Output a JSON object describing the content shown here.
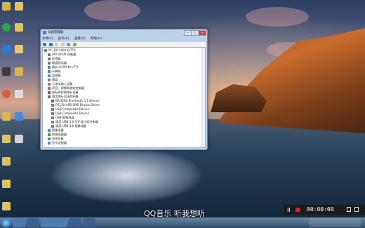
{
  "window": {
    "title": "设备管理器",
    "menu": [
      "文件(F)",
      "操作(A)",
      "查看(V)",
      "帮助(H)"
    ],
    "buttons": {
      "minimize": "—",
      "maximize": "□",
      "close": "✕"
    }
  },
  "tree": [
    "PC-20210812VTTX",
    "ATA ATAPI 控制器",
    "处理器",
    "磁盘驱动器",
    "端口 (COM 和 LPT)",
    "计算机",
    "监视器",
    "键盘",
    "人体学输入设备",
    "声音、视频和游戏控制器",
    "鼠标和其他指针设备",
    "通用串行总线控制器",
    "BRLDNK Bluetooth 5.1 Device",
    "PS130 USB SMS Device Driver",
    "USB Composite Device",
    "USB Composite Device",
    "USB 根集线器",
    "通用 USB 3.0 可扩展主机控制器",
    "通用 USB 3.0 根集线器",
    "图像设备",
    "网络适配器",
    "系统设备",
    "显示适配器"
  ],
  "subtitle": "QQ音乐 听我想听",
  "recorder": {
    "pause": "II",
    "time": "00:00:00"
  },
  "colors": {
    "recorder_stop": "#e02424",
    "title_bar": "#bcd1ea"
  }
}
